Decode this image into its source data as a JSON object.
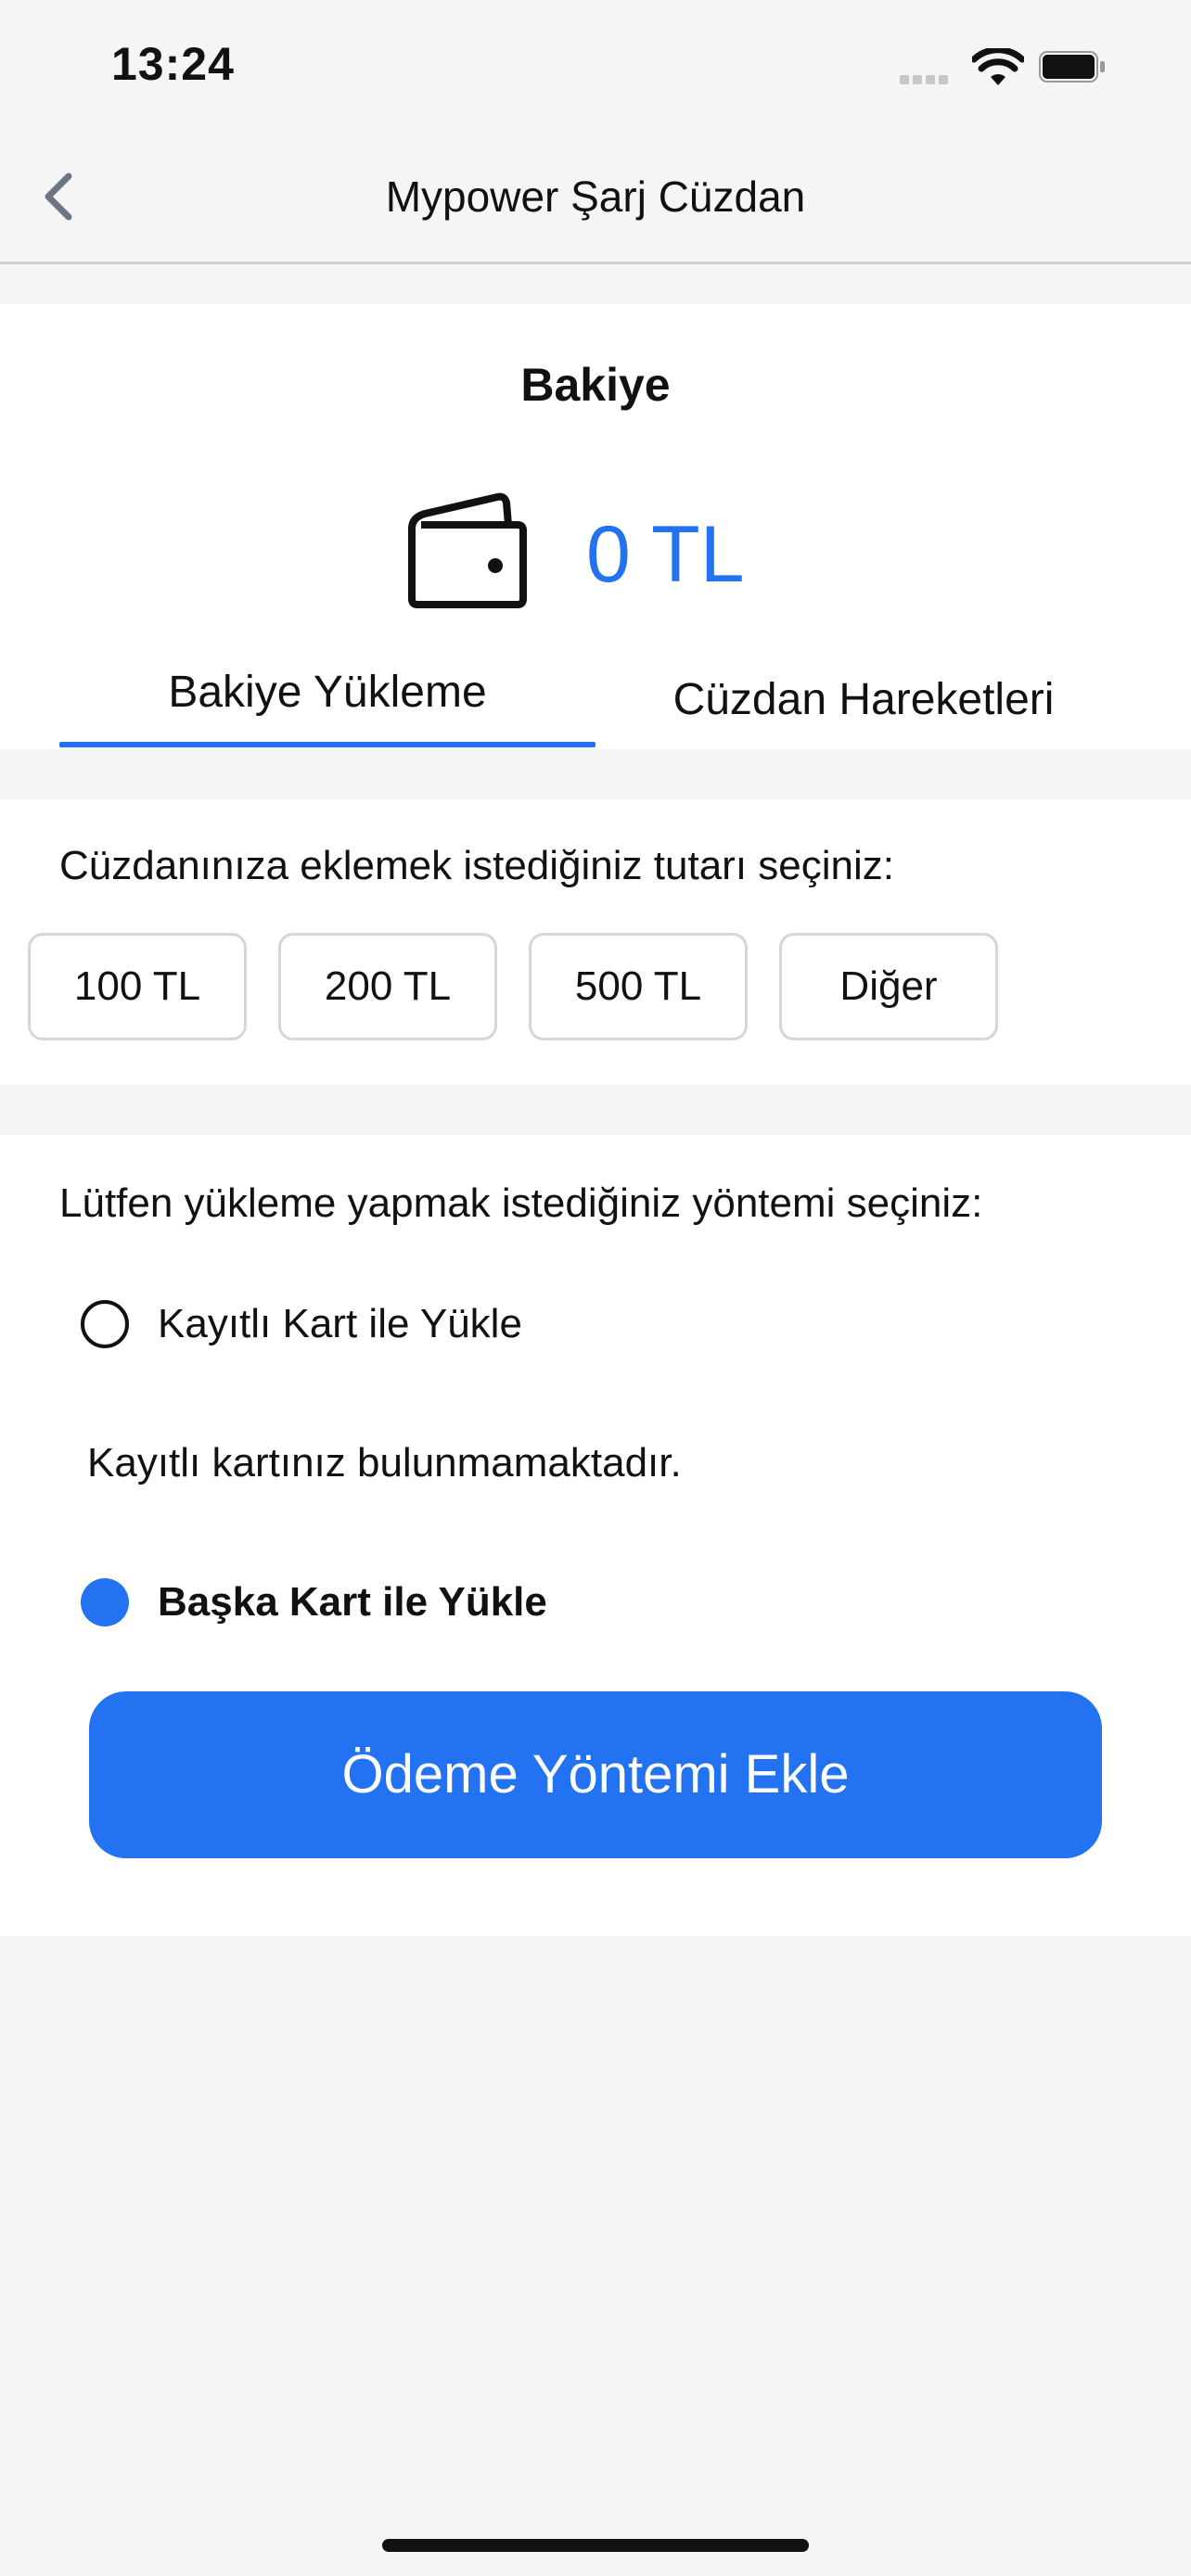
{
  "status_bar": {
    "time": "13:24"
  },
  "nav": {
    "title": "Mypower Şarj Cüzdan"
  },
  "balance": {
    "title": "Bakiye",
    "amount": "0 TL"
  },
  "tabs": [
    {
      "label": "Bakiye Yükleme",
      "active": true
    },
    {
      "label": "Cüzdan Hareketleri",
      "active": false
    }
  ],
  "amount_section": {
    "prompt": "Cüzdanınıza eklemek istediğiniz tutarı seçiniz:",
    "options": [
      "100 TL",
      "200 TL",
      "500 TL",
      "Diğer"
    ]
  },
  "method_section": {
    "prompt": "Lütfen yükleme yapmak istediğiniz yöntemi seçiniz:",
    "saved_card_label": "Kayıtlı Kart ile Yükle",
    "no_saved_card": "Kayıtlı kartınız bulunmamaktadır.",
    "other_card_label": "Başka Kart ile Yükle",
    "selected": "other_card"
  },
  "primary_button": {
    "label": "Ödeme Yöntemi Ekle"
  },
  "colors": {
    "accent": "#2272f2",
    "background": "#f5f5f5",
    "card": "#ffffff"
  }
}
